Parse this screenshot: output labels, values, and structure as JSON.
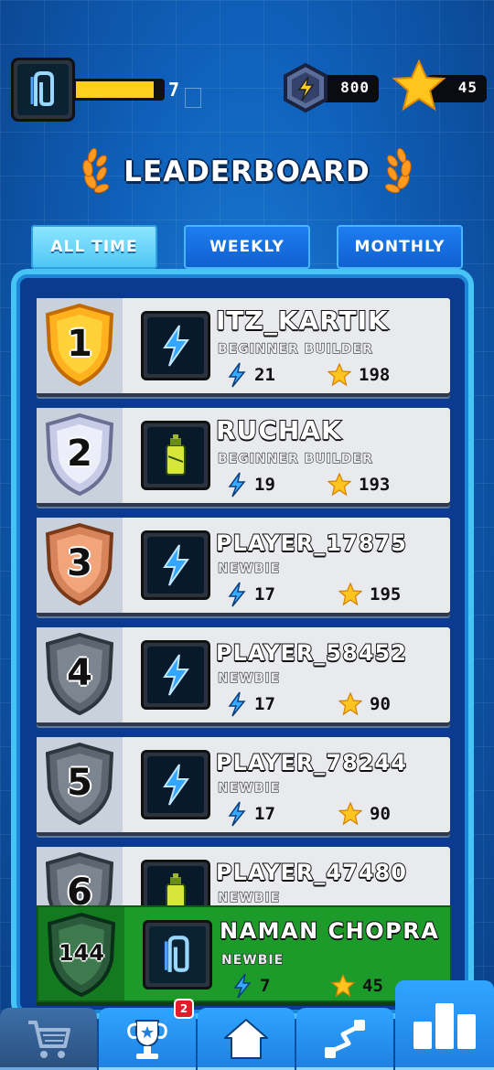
{
  "header": {
    "level": "7",
    "xp_fill": 0.9,
    "energy": "800",
    "stars": "45"
  },
  "title": "LEADERBOARD",
  "tabs": [
    {
      "label": "ALL TIME",
      "active": true
    },
    {
      "label": "WEEKLY",
      "active": false
    },
    {
      "label": "MONTHLY",
      "active": false
    }
  ],
  "leaderboard": [
    {
      "rank": "1",
      "name": "ITZ_KARTIK",
      "title": "BEGINNER BUILDER",
      "energy": "21",
      "stars": "198",
      "shield": "gold",
      "avatar": "lightning-icon"
    },
    {
      "rank": "2",
      "name": "RUCHAK",
      "title": "BEGINNER BUILDER",
      "energy": "19",
      "stars": "193",
      "shield": "silver",
      "avatar": "spray-can-icon"
    },
    {
      "rank": "3",
      "name": "PLAYER_17875",
      "title": "NEWBIE",
      "energy": "17",
      "stars": "195",
      "shield": "bronze",
      "avatar": "lightning-icon"
    },
    {
      "rank": "4",
      "name": "PLAYER_58452",
      "title": "NEWBIE",
      "energy": "17",
      "stars": "90",
      "shield": "gray",
      "avatar": "lightning-icon"
    },
    {
      "rank": "5",
      "name": "PLAYER_78244",
      "title": "NEWBIE",
      "energy": "17",
      "stars": "90",
      "shield": "gray",
      "avatar": "lightning-icon"
    },
    {
      "rank": "6",
      "name": "PLAYER_47480",
      "title": "NEWBIE",
      "energy": "",
      "stars": "",
      "shield": "gray",
      "avatar": "spray-can-icon"
    }
  ],
  "current_user": {
    "rank": "144",
    "name": "NAMAN CHOPRA",
    "title": "NEWBIE",
    "energy": "7",
    "stars": "45",
    "avatar": "paperclip-icon"
  },
  "nav": {
    "items": [
      "shop-icon",
      "trophy-icon",
      "home-icon",
      "path-icon",
      "leaderboard-icon"
    ],
    "trophy_badge": "2"
  },
  "colors": {
    "accent": "#48c3f5",
    "user_row": "#1c9a2a",
    "xp": "#ffcf1e"
  }
}
